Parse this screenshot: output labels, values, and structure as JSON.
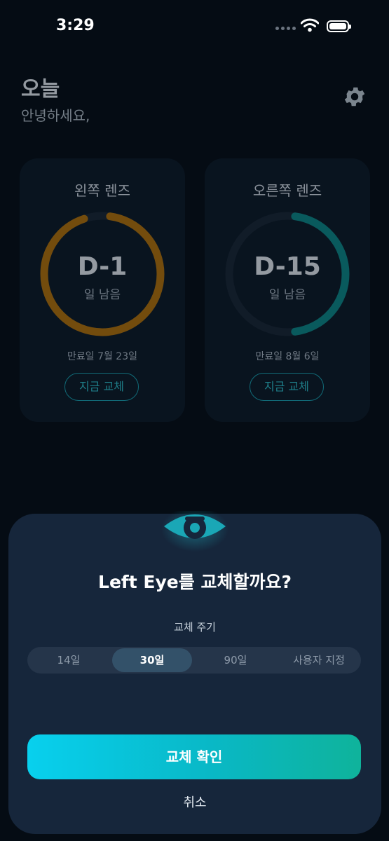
{
  "status_bar": {
    "time": "3:29"
  },
  "header": {
    "title": "오늘",
    "subtitle": "안녕하세요,"
  },
  "cards": [
    {
      "title": "왼쪽 렌즈",
      "countdown": "D-1",
      "remaining_label": "일 남음",
      "expiry": "만료일 7월 23일",
      "button_label": "지금 교체",
      "progress": 0.97,
      "color": "#b8740a"
    },
    {
      "title": "오른쪽 렌즈",
      "countdown": "D-15",
      "remaining_label": "일 남음",
      "expiry": "만료일 8월 6일",
      "button_label": "지금 교체",
      "progress": 0.5,
      "color": "#0e8c8c"
    }
  ],
  "sheet": {
    "title": "Left Eye를 교체할까요?",
    "cycle_label": "교체 주기",
    "options": [
      "14일",
      "30일",
      "90일",
      "사용자 지정"
    ],
    "selected_option": "30일",
    "confirm_label": "교체 확인",
    "cancel_label": "취소"
  },
  "colors": {
    "accent": "#1aa9b8",
    "background": "#050c14",
    "sheet": "#16263b"
  }
}
